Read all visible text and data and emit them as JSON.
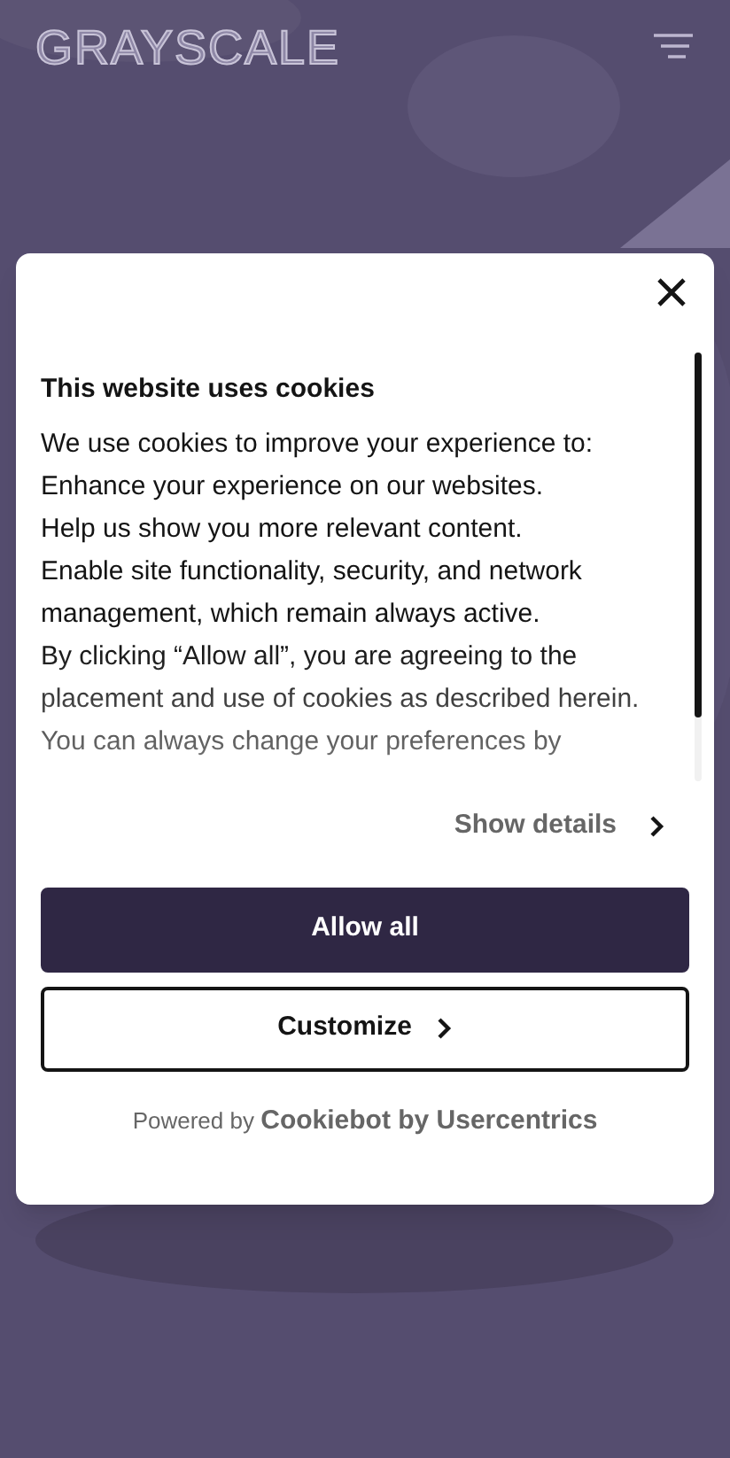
{
  "header": {
    "logo": "GRAYSCALE"
  },
  "dialog": {
    "title": "This website uses cookies",
    "paragraphs": [
      "We use cookies to improve your experience to:",
      "Enhance your experience on our websites.",
      "Help us show you more relevant content.",
      "Enable site functionality, security, and network management, which remain always active.",
      "By clicking “Allow all”, you are agreeing to the placement and use of cookies as described herein. You can always change your preferences by"
    ],
    "show_details": "Show details",
    "buttons": [
      {
        "label": "Allow all",
        "kind": "primary"
      },
      {
        "label": "Customize",
        "kind": "secondary"
      }
    ],
    "powered_prefix": "Powered by",
    "powered_brand": "Cookiebot by Usercentrics"
  }
}
